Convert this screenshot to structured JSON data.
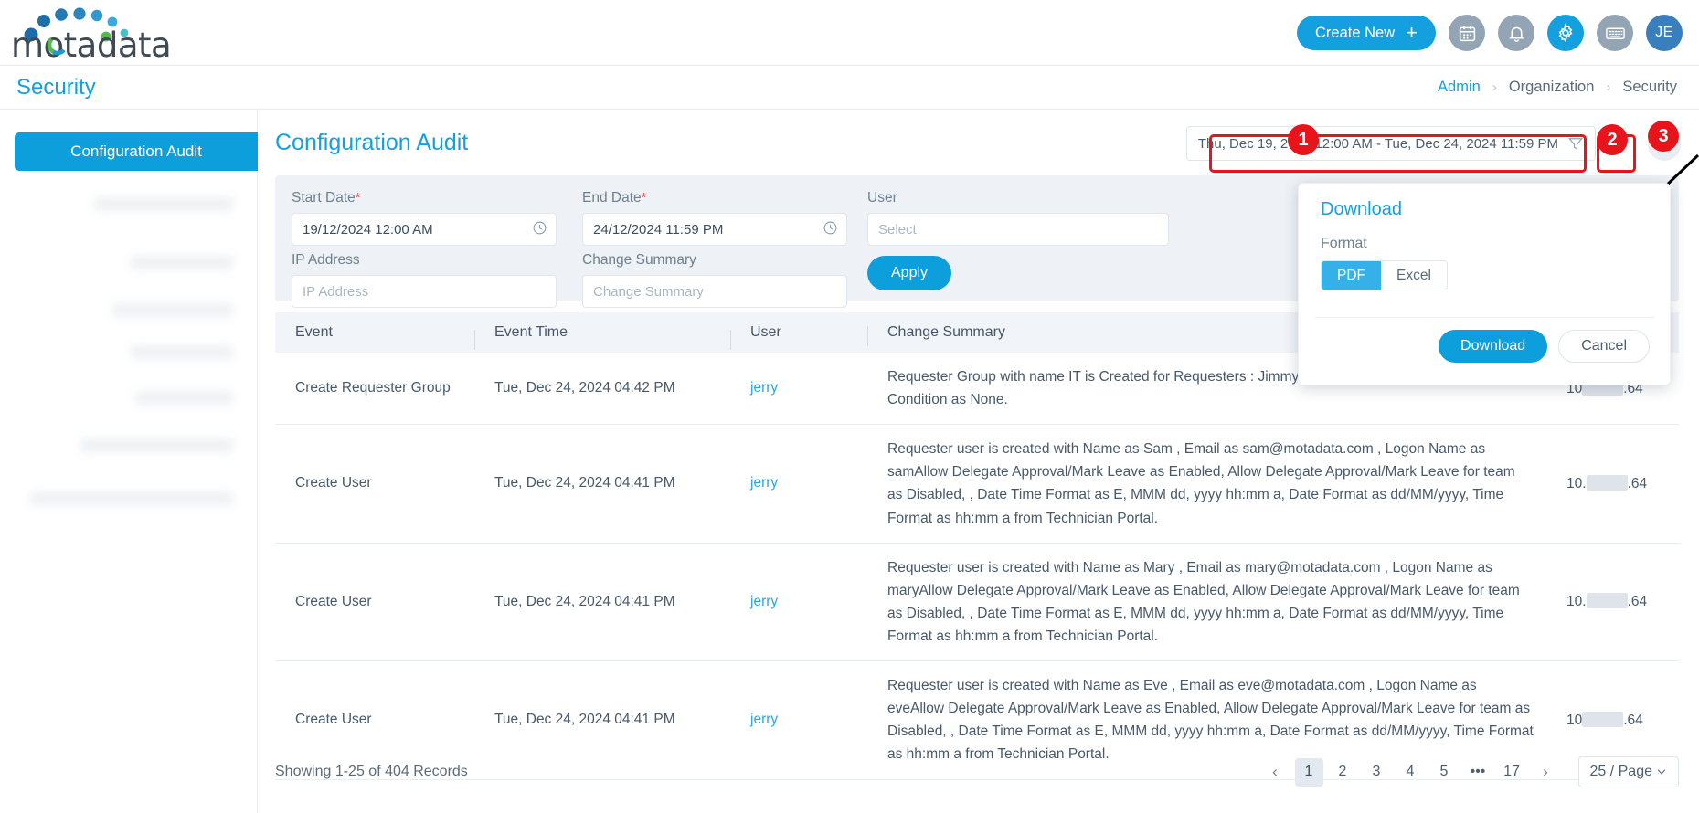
{
  "topbar": {
    "logo_text": "motadata",
    "create_new_label": "Create New",
    "icons": [
      "calendar-icon",
      "bell-icon",
      "gear-icon",
      "keyboard-icon"
    ],
    "avatar_initials": "JE"
  },
  "pagehead": {
    "title": "Security",
    "breadcrumb": [
      {
        "label": "Admin",
        "link": true
      },
      {
        "label": "Organization",
        "link": false
      },
      {
        "label": "Security",
        "link": false
      }
    ],
    "separator": "›"
  },
  "sidebar": {
    "active_item": "Configuration Audit"
  },
  "content": {
    "title": "Configuration Audit",
    "date_range": "Thu, Dec 19, 2024 12:00 AM - Tue, Dec 24, 2024 11:59 PM",
    "filter_icon": "filter-icon",
    "refresh_icon": "refresh-icon",
    "download_icon": "download-icon"
  },
  "filters": {
    "start_date": {
      "label": "Start Date",
      "required": "*",
      "value": "19/12/2024 12:00 AM"
    },
    "end_date": {
      "label": "End Date",
      "required": "*",
      "value": "24/12/2024 11:59 PM"
    },
    "user": {
      "label": "User",
      "placeholder": "Select",
      "value": ""
    },
    "ip_address": {
      "label": "IP Address",
      "placeholder": "IP Address",
      "value": ""
    },
    "change_summary": {
      "label": "Change Summary",
      "placeholder": "Change Summary",
      "value": ""
    },
    "apply_label": "Apply"
  },
  "table": {
    "columns": [
      "Event",
      "Event Time",
      "User",
      "Change Summary",
      ""
    ],
    "rows": [
      {
        "event": "Create Requester Group",
        "time": "Tue, Dec 24, 2024 04:42 PM",
        "user": "jerry",
        "summary": "Requester Group with name IT is Created for Requesters : Jimmy, Liza, Adam, Eve, Mary, Sam , Condition as None.",
        "ip_prefix": "10",
        "ip_suffix": ".64"
      },
      {
        "event": "Create User",
        "time": "Tue, Dec 24, 2024 04:41 PM",
        "user": "jerry",
        "summary": "Requester user is created with Name as Sam , Email as sam@motadata.com , Logon Name as samAllow Delegate Approval/Mark Leave as Enabled, Allow Delegate Approval/Mark Leave for team as Disabled, , Date Time Format as E, MMM dd, yyyy hh:mm a, Date Format as dd/MM/yyyy, Time Format as hh:mm a from Technician Portal.",
        "ip_prefix": "10.",
        "ip_suffix": ".64"
      },
      {
        "event": "Create User",
        "time": "Tue, Dec 24, 2024 04:41 PM",
        "user": "jerry",
        "summary": "Requester user is created with Name as Mary , Email as mary@motadata.com , Logon Name as maryAllow Delegate Approval/Mark Leave as Enabled, Allow Delegate Approval/Mark Leave for team as Disabled, , Date Time Format as E, MMM dd, yyyy hh:mm a, Date Format as dd/MM/yyyy, Time Format as hh:mm a from Technician Portal.",
        "ip_prefix": "10.",
        "ip_suffix": ".64"
      },
      {
        "event": "Create User",
        "time": "Tue, Dec 24, 2024 04:41 PM",
        "user": "jerry",
        "summary": "Requester user is created with Name as Eve , Email as eve@motadata.com , Logon Name as eveAllow Delegate Approval/Mark Leave as Enabled, Allow Delegate Approval/Mark Leave for team as Disabled, , Date Time Format as E, MMM dd, yyyy hh:mm a, Date Format as dd/MM/yyyy, Time Format as hh:mm a from Technician Portal.",
        "ip_prefix": "10",
        "ip_suffix": ".64"
      }
    ]
  },
  "pagination": {
    "info": "Showing 1-25 of 404 Records",
    "prev": "‹",
    "next": "›",
    "pages": [
      "1",
      "2",
      "3",
      "4",
      "5",
      "•••",
      "17"
    ],
    "active_page": "1",
    "per_page": "25 / Page"
  },
  "download_popup": {
    "title": "Download",
    "format_label": "Format",
    "options": [
      "PDF",
      "Excel"
    ],
    "selected_format": "PDF",
    "download_label": "Download",
    "cancel_label": "Cancel"
  },
  "annotations": {
    "badges": [
      "1",
      "2",
      "3"
    ],
    "accent": "#e8141b"
  },
  "colors": {
    "brand_blue": "#14a0de",
    "panel_bg": "#eef2f6",
    "text": "#3d4f5d"
  }
}
